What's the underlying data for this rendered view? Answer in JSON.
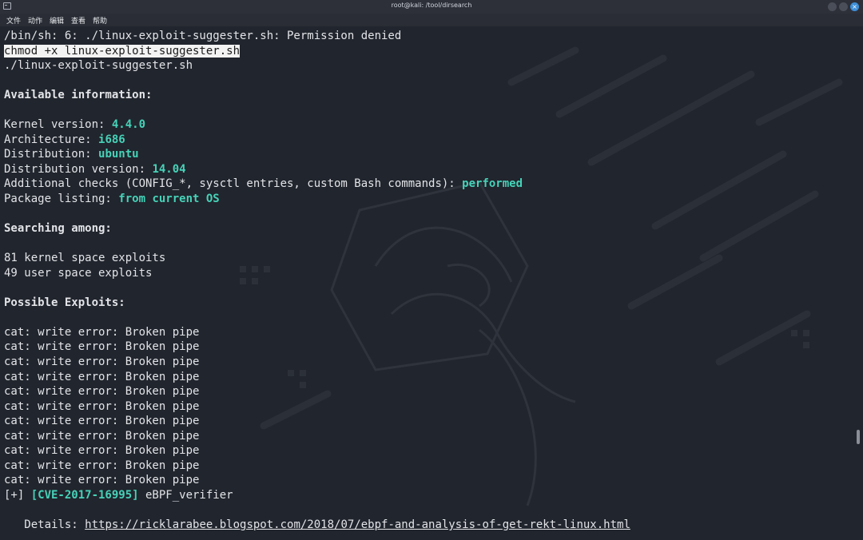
{
  "window": {
    "title": "root@kali: /tool/dirsearch",
    "close_glyph": "×"
  },
  "menu": [
    "文件",
    "动作",
    "编辑",
    "查看",
    "帮助"
  ],
  "terminal": {
    "l01": "/bin/sh: 6: ./linux-exploit-suggester.sh: Permission denied",
    "l02": "chmod +x linux-exploit-suggester.sh",
    "l03": "./linux-exploit-suggester.sh",
    "l05": "Available information:",
    "kernel_label": "Kernel version: ",
    "kernel_value": "4.4.0",
    "arch_label": "Architecture: ",
    "arch_value": "i686",
    "dist_label": "Distribution: ",
    "dist_value": "ubuntu",
    "distver_label": "Distribution version: ",
    "distver_value": "14.04",
    "checks_label": "Additional checks (CONFIG_*, sysctl entries, custom Bash commands): ",
    "checks_value": "performed",
    "pkg_label": "Package listing: ",
    "pkg_value": "from current OS",
    "searching": "Searching among:",
    "kernel_exploits": "81 kernel space exploits",
    "user_exploits": "49 user space exploits",
    "possible": "Possible Exploits:",
    "cat_error": "cat: write error: Broken pipe",
    "cve_prefix": "[+] ",
    "cve_id": "[CVE-2017-16995]",
    "cve_name": " eBPF_verifier",
    "details_label": "   Details: ",
    "details_url": "https://ricklarabee.blogspot.com/2018/07/ebpf-and-analysis-of-get-rekt-linux.html"
  },
  "colors": {
    "background": "#21252d",
    "accent": "#46d2b8",
    "text": "#e2e4e8"
  }
}
